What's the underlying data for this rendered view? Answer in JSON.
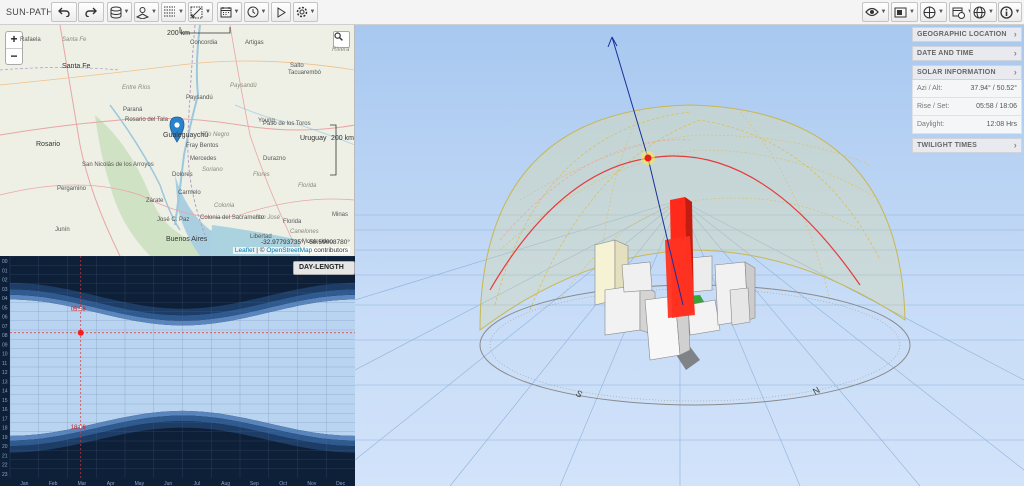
{
  "toolbar": {
    "title": "SUN-PATH:",
    "left_buttons": [
      "undo-icon",
      "redo-icon",
      "layers-icon",
      "model-icon",
      "grid-icon",
      "sketch-icon",
      "calendar-icon",
      "clock-icon",
      "play-icon",
      "settings-icon"
    ],
    "right_buttons": [
      "eye-icon",
      "display-icon",
      "globe-alt-icon",
      "calendar-clock-icon",
      "globe-icon",
      "info-icon"
    ]
  },
  "map": {
    "scale_top": "200 km",
    "scale_right": "200 km",
    "marker_label": "Gualeguaychú",
    "coords": "-32.97793735°, -58.59008780°",
    "attribution_leaflet": "Leaflet",
    "attribution_sep": " | © ",
    "attribution_osm": "OpenStreetMap",
    "attribution_tail": " contributors",
    "places": [
      {
        "name": "Rafaela",
        "cls": ""
      },
      {
        "name": "Santa Fe",
        "cls": "ital"
      },
      {
        "name": "Santa Fe",
        "cls": "big"
      },
      {
        "name": "Concordia",
        "cls": ""
      },
      {
        "name": "Artigas",
        "cls": ""
      },
      {
        "name": "Rivera",
        "cls": "ital"
      },
      {
        "name": "Salto",
        "cls": ""
      },
      {
        "name": "Tacuarembó",
        "cls": ""
      },
      {
        "name": "Entre Ríos",
        "cls": "ital"
      },
      {
        "name": "Paysandú",
        "cls": "ital"
      },
      {
        "name": "Paysandú",
        "cls": ""
      },
      {
        "name": "Paraná",
        "cls": ""
      },
      {
        "name": "Rosario del Tala",
        "cls": ""
      },
      {
        "name": "Young",
        "cls": ""
      },
      {
        "name": "Río Negro",
        "cls": "ital"
      },
      {
        "name": "Paso de los Toros",
        "cls": ""
      },
      {
        "name": "Uruguay",
        "cls": "big"
      },
      {
        "name": "Rosario",
        "cls": "big"
      },
      {
        "name": "Fray Bentos",
        "cls": ""
      },
      {
        "name": "San Nicolás de los Arroyos",
        "cls": ""
      },
      {
        "name": "Mercedes",
        "cls": ""
      },
      {
        "name": "Soriano",
        "cls": "ital"
      },
      {
        "name": "Durazno",
        "cls": ""
      },
      {
        "name": "Dolores",
        "cls": ""
      },
      {
        "name": "Flores",
        "cls": "ital"
      },
      {
        "name": "Pergamino",
        "cls": ""
      },
      {
        "name": "Florida",
        "cls": "ital"
      },
      {
        "name": "Carmelo",
        "cls": ""
      },
      {
        "name": "Zárate",
        "cls": ""
      },
      {
        "name": "Colonia",
        "cls": "ital"
      },
      {
        "name": "San José",
        "cls": "ital"
      },
      {
        "name": "Colonia del Sacramento",
        "cls": ""
      },
      {
        "name": "Florida",
        "cls": ""
      },
      {
        "name": "José C. Paz",
        "cls": ""
      },
      {
        "name": "Minas",
        "cls": ""
      },
      {
        "name": "Junín",
        "cls": ""
      },
      {
        "name": "Buenos Aires",
        "cls": "big"
      },
      {
        "name": "Libertad",
        "cls": ""
      },
      {
        "name": "Canelones",
        "cls": "ital"
      },
      {
        "name": "Montevideo",
        "cls": ""
      }
    ]
  },
  "day_length": {
    "button_label": "DAY-LENGTH",
    "sunrise_label": "05:58",
    "sunset_label": "18:06",
    "hour_ticks": [
      "00",
      "01",
      "02",
      "03",
      "04",
      "05",
      "06",
      "07",
      "08",
      "09",
      "10",
      "11",
      "12",
      "13",
      "14",
      "15",
      "16",
      "17",
      "18",
      "19",
      "20",
      "21",
      "22",
      "23"
    ],
    "months": [
      "Jan",
      "Feb",
      "Mar",
      "Apr",
      "May",
      "Jun",
      "Jul",
      "Aug",
      "Sep",
      "Oct",
      "Nov",
      "Dec"
    ]
  },
  "panel": {
    "geo": "GEOGRAPHIC LOCATION",
    "date": "DATE AND TIME",
    "solar": "SOLAR INFORMATION",
    "rows": [
      {
        "label": "Azi / Alt:",
        "value": "37.94° / 50.52°"
      },
      {
        "label": "Rise / Set:",
        "value": "05:58 / 18:06"
      },
      {
        "label": "Daylight:",
        "value": "12:08 Hrs"
      }
    ],
    "twilight": "TWILIGHT TIMES"
  }
}
